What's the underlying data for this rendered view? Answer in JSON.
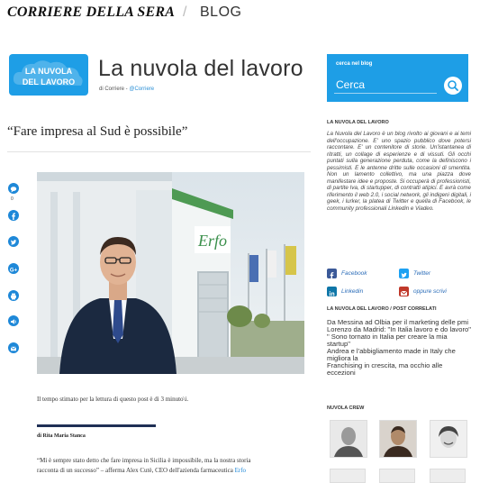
{
  "header": {
    "brand": "CORRIERE DELLA SERA",
    "separator": "/",
    "section": "BLOG"
  },
  "blog": {
    "logo_line1": "LA NUVOLA",
    "logo_line2": "DEL LAVORO",
    "title": "La nuvola del lavoro",
    "subtitle_prefix": "di Corriere -",
    "subtitle_handle": "@Corriere",
    "brand_color": "#1e9ee6"
  },
  "search": {
    "label": "cerca nel blog",
    "placeholder": "Cerca",
    "button_icon": "search-icon"
  },
  "article": {
    "headline": "“Fare impresa al Sud è possibile”",
    "comment_count": "0",
    "share_icons": [
      "comment-icon",
      "facebook-icon",
      "twitter-icon",
      "google-plus-icon",
      "print-icon",
      "listen-icon",
      "email-icon"
    ],
    "reading_time": "Il tempo stimato per la lettura di questo post è di 3 minuto\\i.",
    "author": "di Rita Maria Stanca",
    "body_line1": "“Mi è sempre stato detto che fare impresa in Sicilia è impossibile, ma la nostra storia",
    "body_line2_text": "racconta di un successo” – afferma Alex Cutè, CEO dell'azienda farmaceutica",
    "body_line2_link": "Erfo"
  },
  "sidebar": {
    "about_heading": "LA NUVOLA DEL LAVORO",
    "about_text": "La Nuvola del Lavoro è un blog rivolto ai giovani e ai temi dell'occupazione. E' uno spazio pubblico dove potersi raccontare. E' un contenitore di storie. Un'istantanea di ritratti, un collage di esperienze e di vissuti. Gli occhi puntati sulla generazione perduta, come la definiscono i pessimisti. E le antenne dritte sulle occasioni di smentita. Non un lamento collettivo, ma una piazza dove manifestare idee e proposte. Si occuperà di professionisti, di partite Iva, di startupper, di contratti atipici. E avrà come riferimento il web 2.0, i social network, gli indigeni digitali, i geek, i lurker, la platea di Twitter e quella di Facebook, le community professionali Linkedin e Viadeo.",
    "social": [
      {
        "label": "Facebook",
        "icon": "facebook-icon",
        "color": "#3b5998"
      },
      {
        "label": "Twitter",
        "icon": "twitter-icon",
        "color": "#1da1f2"
      },
      {
        "label": "Linkedin",
        "icon": "linkedin-icon",
        "color": "#0e76a8"
      },
      {
        "label": "oppure scrivi",
        "icon": "email-icon",
        "color": "#c0392b"
      }
    ],
    "related_heading": "LA NUVOLA DEL LAVORO / POST CORRELATI",
    "related": [
      "Da Messina ad Olbia per il marketing delle pmi",
      "Lorenzo da Madrid: \"In Italia lavoro e do lavoro\"",
      "\" Sono tornato in Italia per creare la mia startup\"",
      "Andrea e l'abbigliamento made in Italy che migliora la",
      "Franchising in crescita, ma occhio alle eccezioni"
    ],
    "crew_heading": "NUVOLA CREW"
  }
}
